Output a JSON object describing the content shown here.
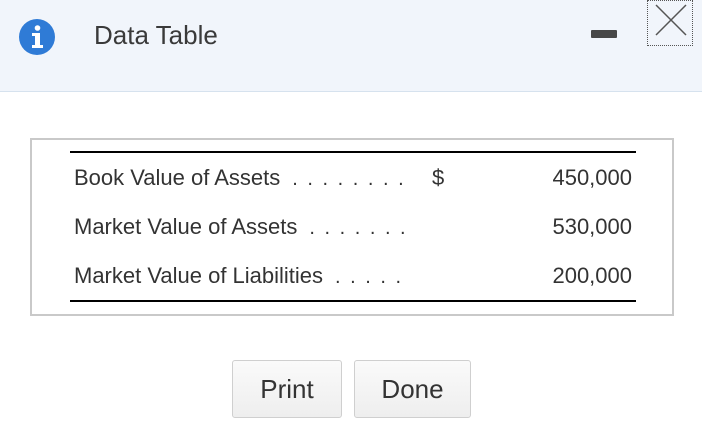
{
  "dialog": {
    "title": "Data Table",
    "info_icon": "info-icon",
    "minimize_icon": "minimize-icon",
    "close_icon": "close-icon"
  },
  "table": {
    "rows": [
      {
        "label": "Book Value of Assets",
        "dots": ". . . . . . . .",
        "currency": "$",
        "value": "450,000"
      },
      {
        "label": "Market Value of Assets",
        "dots": ". . . . . . .",
        "currency": "",
        "value": "530,000"
      },
      {
        "label": "Market Value of Liabilities",
        "dots": ". . . . .",
        "currency": "",
        "value": "200,000"
      }
    ]
  },
  "buttons": {
    "print": "Print",
    "done": "Done"
  },
  "colors": {
    "info_blue": "#2f7bd6",
    "titlebar_bg": "#f1f5fb"
  }
}
